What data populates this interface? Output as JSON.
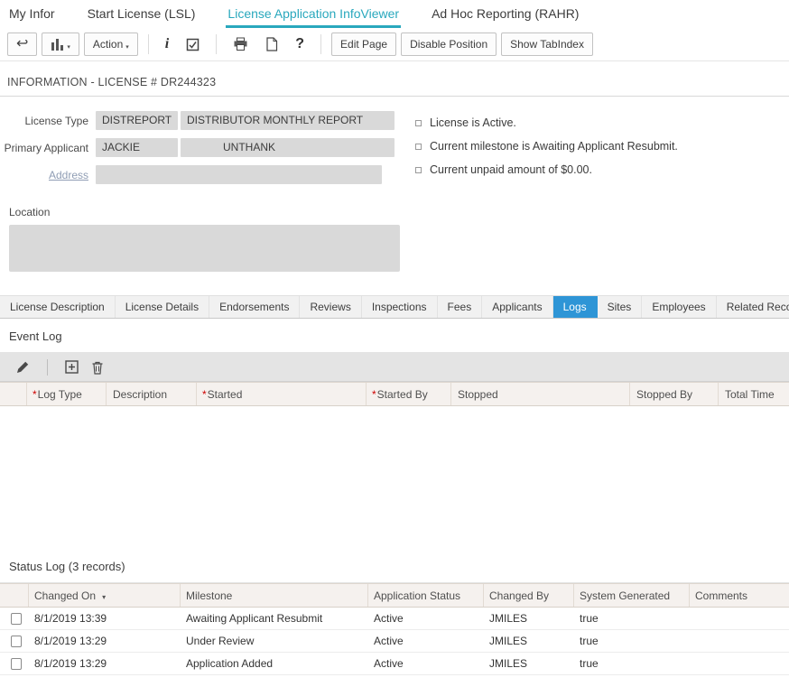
{
  "top_tabs": [
    {
      "label": "My Infor"
    },
    {
      "label": "Start License (LSL)"
    },
    {
      "label": "License Application InfoViewer"
    },
    {
      "label": "Ad Hoc Reporting (RAHR)"
    }
  ],
  "icons": {
    "back": "↩",
    "info": "i",
    "help": "?",
    "dropdown_arrow": "▾"
  },
  "toolbar": {
    "action_label": "Action",
    "edit_page_label": "Edit Page",
    "disable_position_label": "Disable Position",
    "show_tabindex_label": "Show TabIndex"
  },
  "info": {
    "title": "INFORMATION - LICENSE # DR244323",
    "license_type_label": "License Type",
    "license_type_code": "DISTREPORT",
    "license_type_desc": "DISTRIBUTOR MONTHLY REPORT",
    "primary_applicant_label": "Primary Applicant",
    "primary_first": "JACKIE",
    "primary_last": "UNTHANK",
    "address_label": "Address",
    "location_label": "Location",
    "status_items": [
      "License is Active.",
      "Current milestone is Awaiting Applicant Resubmit.",
      "Current unpaid amount of $0.00."
    ]
  },
  "detail_tabs": [
    {
      "label": "License Description"
    },
    {
      "label": "License Details"
    },
    {
      "label": "Endorsements"
    },
    {
      "label": "Reviews"
    },
    {
      "label": "Inspections"
    },
    {
      "label": "Fees"
    },
    {
      "label": "Applicants"
    },
    {
      "label": "Logs"
    },
    {
      "label": "Sites"
    },
    {
      "label": "Employees"
    },
    {
      "label": "Related Records"
    }
  ],
  "event_log": {
    "title": "Event Log",
    "columns": [
      {
        "marker": "*",
        "label": "Log Type"
      },
      {
        "marker": "",
        "label": "Description"
      },
      {
        "marker": "*",
        "label": "Started"
      },
      {
        "marker": "*",
        "label": "Started By"
      },
      {
        "marker": "",
        "label": "Stopped"
      },
      {
        "marker": "",
        "label": "Stopped By"
      },
      {
        "marker": "",
        "label": "Total Time"
      }
    ]
  },
  "status_log": {
    "title": "Status Log (3 records)",
    "sort_arrow": "▾",
    "columns": [
      "Changed On",
      "Milestone",
      "Application Status",
      "Changed By",
      "System Generated",
      "Comments"
    ],
    "rows": [
      [
        "8/1/2019 13:39",
        "Awaiting Applicant Resubmit",
        "Active",
        "JMILES",
        "true",
        ""
      ],
      [
        "8/1/2019 13:29",
        "Under Review",
        "Active",
        "JMILES",
        "true",
        ""
      ],
      [
        "8/1/2019 13:29",
        "Application Added",
        "Active",
        "JMILES",
        "true",
        ""
      ]
    ]
  },
  "colors": {
    "active_tab_teal": "#29a8bd",
    "active_subtab_blue": "#2e95d6",
    "field_gray": "#d9d9d9",
    "required_red": "#cc0000"
  }
}
